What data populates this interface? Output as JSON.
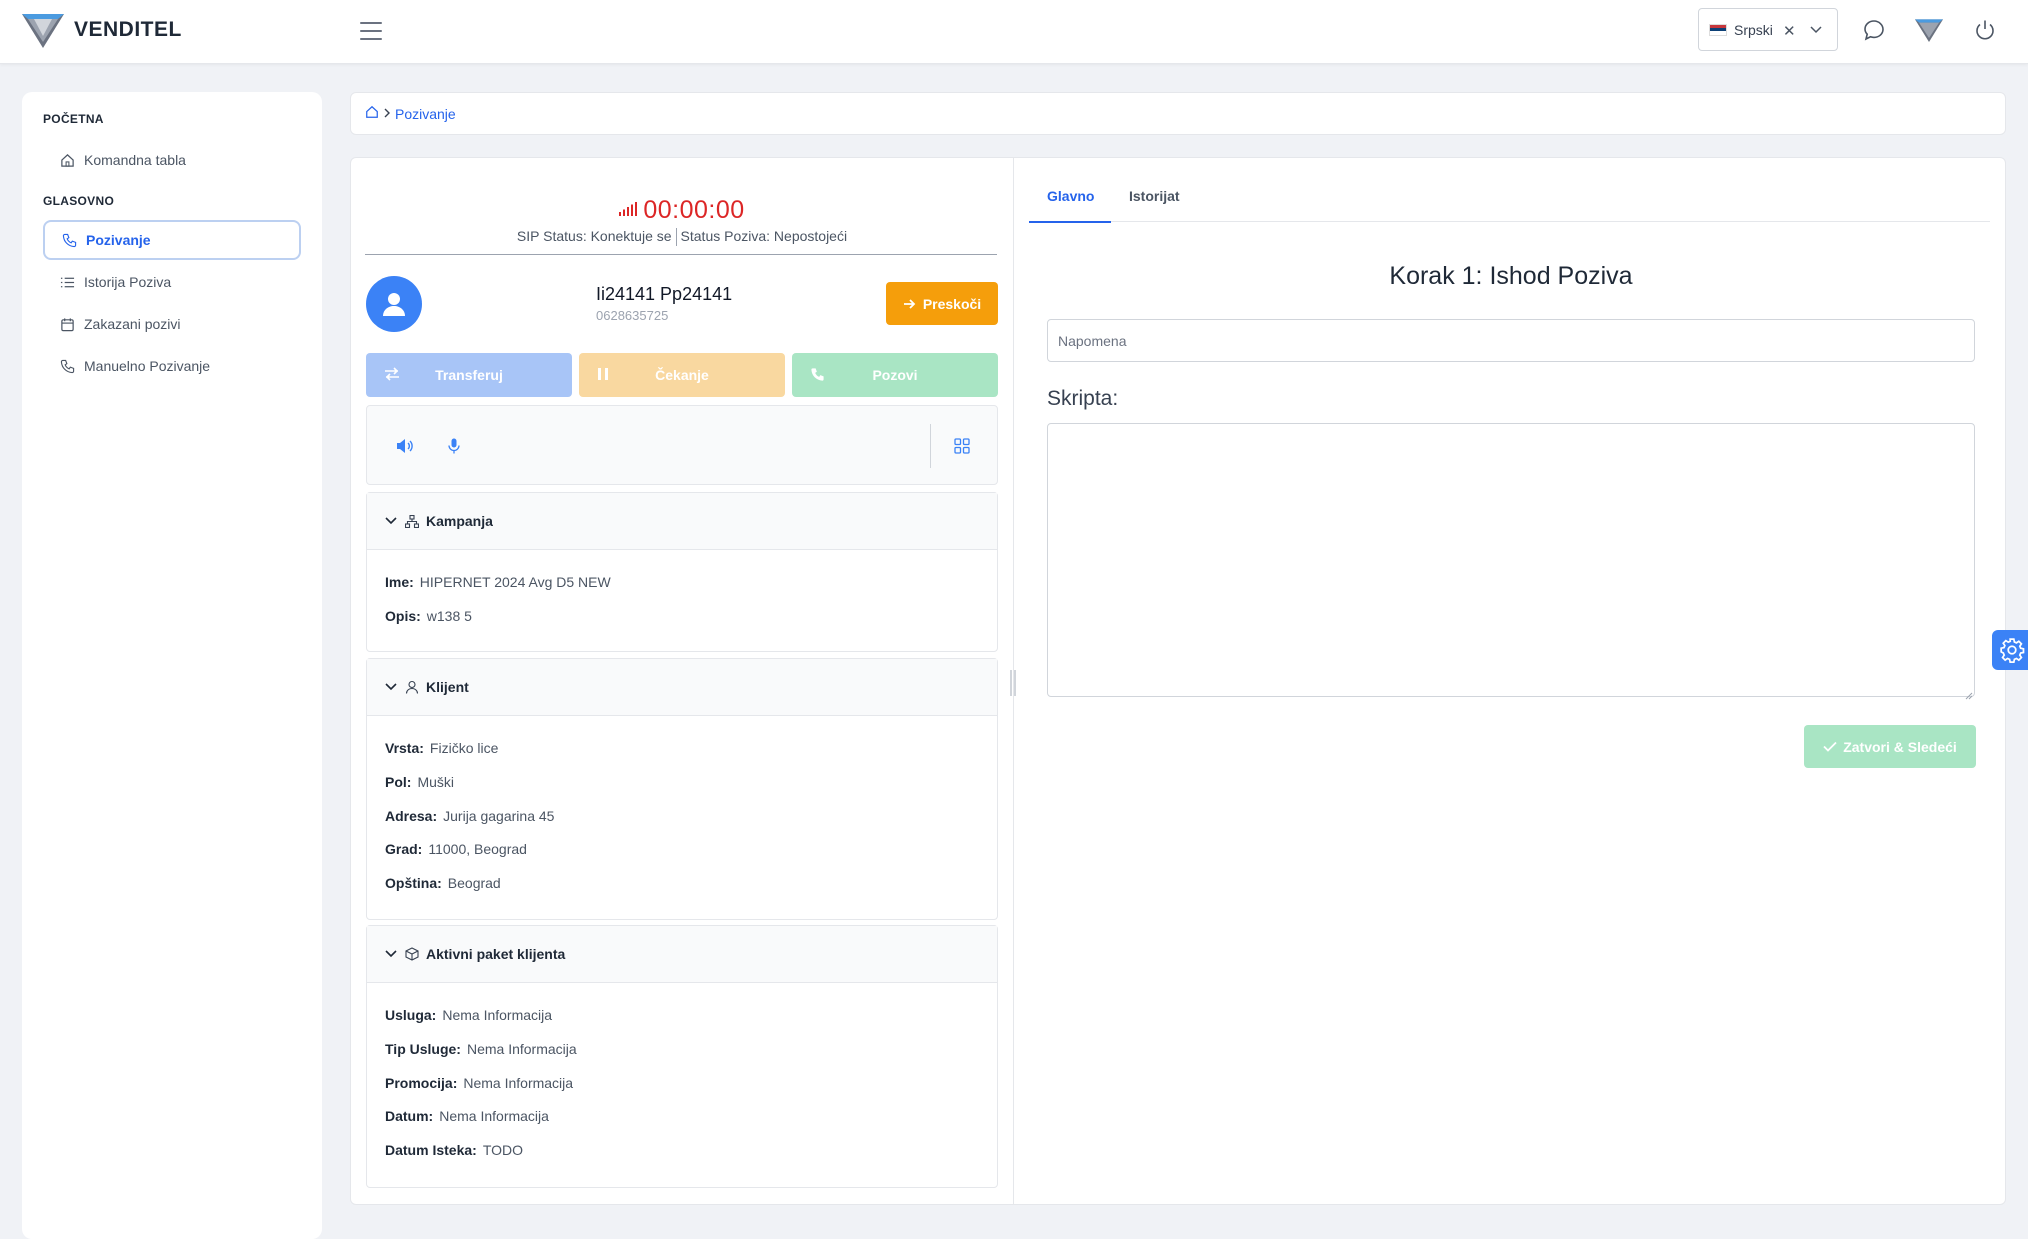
{
  "header": {
    "brand": "VENDITEL",
    "language": {
      "selected": "Srpski",
      "clear_symbol": "✕"
    }
  },
  "sidebar": {
    "sections": [
      {
        "title": "POČETNA",
        "items": [
          {
            "label": "Komandna tabla",
            "icon": "home-icon"
          }
        ]
      },
      {
        "title": "GLASOVNO",
        "items": [
          {
            "label": "Pozivanje",
            "icon": "phone-icon",
            "active": true
          },
          {
            "label": "Istorija Poziva",
            "icon": "list-icon"
          },
          {
            "label": "Zakazani pozivi",
            "icon": "calendar-icon"
          },
          {
            "label": "Manuelno Pozivanje",
            "icon": "phone-icon"
          }
        ]
      }
    ]
  },
  "breadcrumb": {
    "current": "Pozivanje"
  },
  "call": {
    "timer": "00:00:00",
    "sip_status": "SIP Status: Konektuje se",
    "call_status": "Status Poziva: Nepostojeći",
    "contact_name": "Ii24141 Pp24141",
    "contact_phone": "0628635725",
    "skip_label": "Preskoči",
    "buttons": {
      "transfer": "Transferuj",
      "hold": "Čekanje",
      "call": "Pozovi"
    }
  },
  "campaign": {
    "title": "Kampanja",
    "rows": [
      {
        "label": "Ime:",
        "value": "HIPERNET 2024 Avg D5 NEW"
      },
      {
        "label": "Opis:",
        "value": "w138 5"
      }
    ]
  },
  "client": {
    "title": "Klijent",
    "rows": [
      {
        "label": "Vrsta:",
        "value": "Fizičko lice"
      },
      {
        "label": "Pol:",
        "value": "Muški"
      },
      {
        "label": "Adresa:",
        "value": "Jurija gagarina 45"
      },
      {
        "label": "Grad:",
        "value": "11000, Beograd"
      },
      {
        "label": "Opština:",
        "value": "Beograd"
      }
    ]
  },
  "package": {
    "title": "Aktivni paket klijenta",
    "rows": [
      {
        "label": "Usluga:",
        "value": "Nema Informacija"
      },
      {
        "label": "Tip Usluge:",
        "value": "Nema Informacija"
      },
      {
        "label": "Promocija:",
        "value": "Nema Informacija"
      },
      {
        "label": "Datum:",
        "value": "Nema Informacija"
      },
      {
        "label": "Datum Isteka:",
        "value": "TODO"
      }
    ]
  },
  "right": {
    "tabs": [
      {
        "label": "Glavno",
        "active": true
      },
      {
        "label": "Istorijat"
      }
    ],
    "step_title": "Korak 1: Ishod Poziva",
    "note_placeholder": "Napomena",
    "script_label": "Skripta:",
    "close_next_label": "Zatvori & Sledeći"
  },
  "colors": {
    "accent": "#2563eb",
    "warning": "#f59e0b",
    "danger": "#dc2626",
    "success_light": "#a9e5c4"
  }
}
